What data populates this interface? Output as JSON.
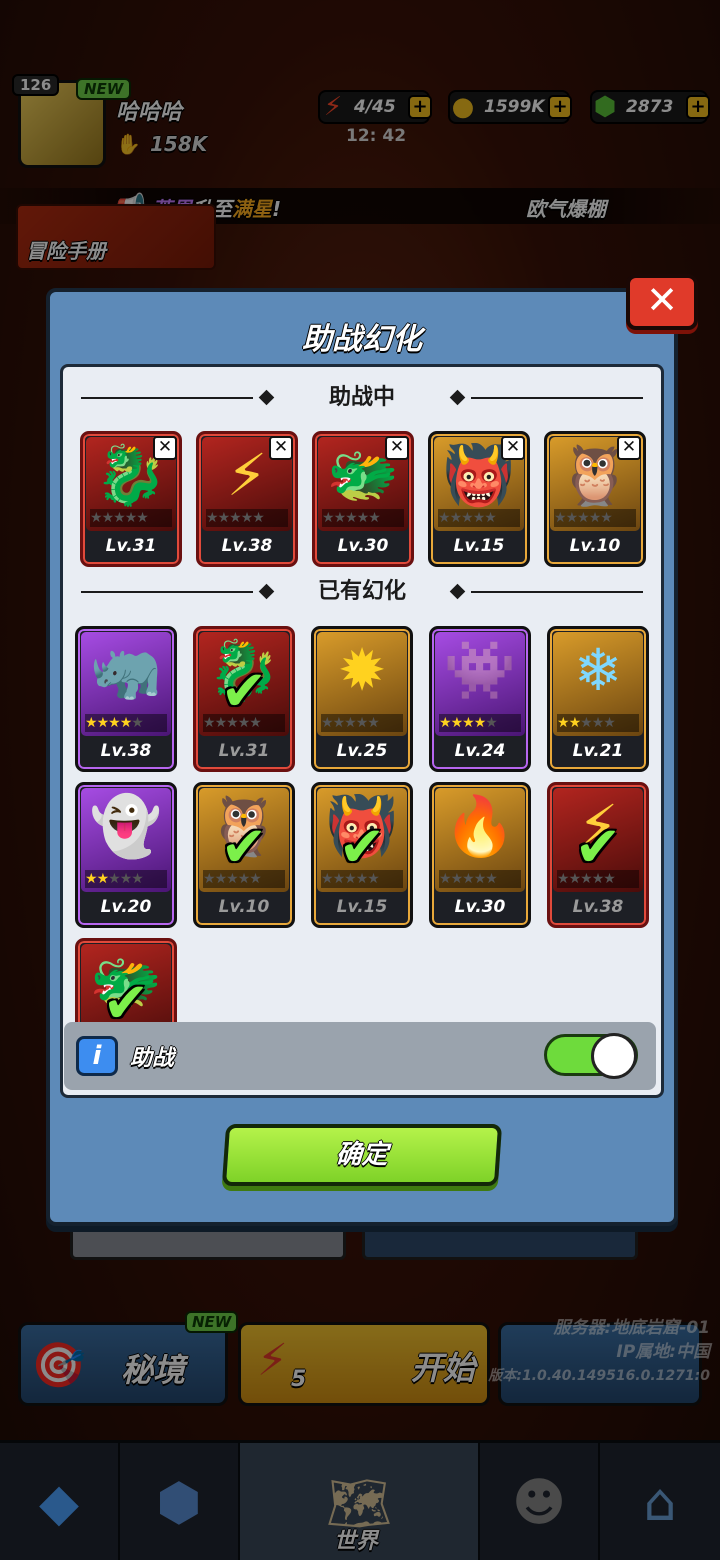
{
  "hud": {
    "level": "126",
    "new_badge": "NEW",
    "player_name": "哈哈哈",
    "power": "158K",
    "energy": "4/45",
    "energy_timer": "12: 42",
    "coins": "1599K",
    "gems": "2873"
  },
  "announcement": {
    "name": "莱恩",
    "middle": "升至",
    "highlight": "满星",
    "end": "!",
    "right": "欧气爆棚"
  },
  "guide": {
    "label": "冒险手册"
  },
  "modal": {
    "title": "助战幻化",
    "section_active": "助战中",
    "section_owned": "已有幻化",
    "active_cards": [
      {
        "level": "Lv.31",
        "icon": "dark-dragon",
        "bg": "red"
      },
      {
        "level": "Lv.38",
        "icon": "golden-claw",
        "bg": "red"
      },
      {
        "level": "Lv.30",
        "icon": "green-dragon",
        "bg": "red"
      },
      {
        "level": "Lv.15",
        "icon": "blue-demon",
        "bg": "gold"
      },
      {
        "level": "Lv.10",
        "icon": "leaf-beast",
        "bg": "gold"
      }
    ],
    "owned_cards": [
      {
        "level": "Lv.38",
        "icon": "horned-beast",
        "bg": "purple",
        "stars": 4,
        "selected": false
      },
      {
        "level": "Lv.31",
        "icon": "dark-dragon",
        "bg": "red",
        "stars": 0,
        "selected": true
      },
      {
        "level": "Lv.25",
        "icon": "spiky-yellow",
        "bg": "gold",
        "stars": 0,
        "selected": false
      },
      {
        "level": "Lv.24",
        "icon": "fanged-beast",
        "bg": "purple",
        "stars": 4,
        "selected": false
      },
      {
        "level": "Lv.21",
        "icon": "ice-crystal",
        "bg": "gold",
        "stars": 2,
        "selected": false
      },
      {
        "level": "Lv.20",
        "icon": "slime-ghost",
        "bg": "purple",
        "stars": 2,
        "selected": false
      },
      {
        "level": "Lv.10",
        "icon": "leaf-beast",
        "bg": "gold",
        "stars": 0,
        "selected": true
      },
      {
        "level": "Lv.15",
        "icon": "blue-demon",
        "bg": "gold",
        "stars": 0,
        "selected": true
      },
      {
        "level": "Lv.30",
        "icon": "lava-golem",
        "bg": "gold",
        "stars": 0,
        "selected": false
      },
      {
        "level": "Lv.38",
        "icon": "golden-claw",
        "bg": "red",
        "stars": 0,
        "selected": true
      },
      {
        "level": "",
        "icon": "green-dragon",
        "bg": "red",
        "stars": 0,
        "selected": true
      }
    ],
    "toggle_label": "助战",
    "toggle_on": true,
    "confirm_label": "确定"
  },
  "bottom": {
    "secret_label": "秘境",
    "new_badge": "NEW",
    "start_label": "开始",
    "start_cost": "5",
    "server_line1": "服务器:地底岩窟-01",
    "server_line2": "IP属地:中国",
    "server_line3": "版本:1.0.40.149516.0.1271:0",
    "nav_world": "世界"
  },
  "colors": {
    "modal_bg": "#5d8ab8",
    "panel_bg": "#e9edf3",
    "confirm_green": "#8fdc2e",
    "close_red": "#e03a2a",
    "toggle_green": "#6edb3c"
  }
}
